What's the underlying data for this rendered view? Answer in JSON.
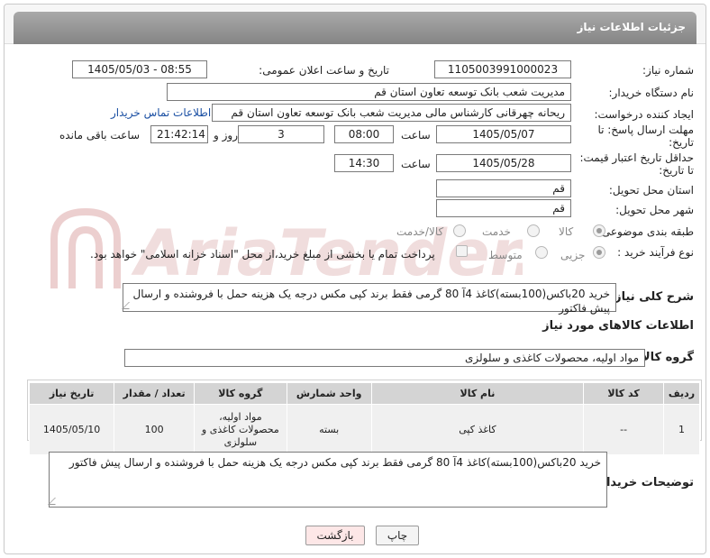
{
  "header": {
    "title": "جزئیات اطلاعات نیاز"
  },
  "fields": {
    "need_number_label": "شماره نیاز:",
    "need_number": "1105003991000023",
    "announce_label": "تاریخ و ساعت اعلان عمومی:",
    "announce_value": "1405/05/03 - 08:55",
    "buyer_org_label": "نام دستگاه خریدار:",
    "buyer_org": "مدیریت شعب بانک توسعه تعاون استان قم",
    "requester_label": "ایجاد کننده درخواست:",
    "requester": "ریحانه چهرقانی کارشناس مالی مدیریت شعب بانک توسعه تعاون استان قم",
    "contact_link": "اطلاعات تماس خریدار",
    "deadline_label_1": "مهلت ارسال پاسخ: تا",
    "deadline_label_2": "تاریخ:",
    "deadline_date": "1405/05/07",
    "time_label": "ساعت",
    "deadline_time": "08:00",
    "days_value": "3",
    "days_label": "روز و",
    "remaining_time": "21:42:14",
    "remaining_label": "ساعت باقی مانده",
    "min_validity_label_1": "حداقل تاریخ اعتبار قیمت:",
    "min_validity_label_2": "تا تاریخ:",
    "validity_date": "1405/05/28",
    "validity_time": "14:30",
    "province_label": "استان محل تحویل:",
    "province": "قم",
    "city_label": "شهر محل تحویل:",
    "city": "قم",
    "category_label": "طبقه بندی موضوعی:",
    "category_options": [
      "کالا",
      "خدمت",
      "کالا/خدمت"
    ],
    "process_label": "نوع فرآیند خرید :",
    "process_options": [
      "جزیی",
      "متوسط"
    ],
    "payment_note": "پرداخت تمام یا بخشی از مبلغ خرید،از محل \"اسناد خزانه اسلامی\" خواهد بود."
  },
  "summary": {
    "label": "شرح کلی نیاز:",
    "text": "خرید 20باکس(100بسته)کاغذ  4آ 80 گرمی فقط برند کپی مکس درجه یک هزینه حمل با فروشنده و ارسال پیش فاکتور"
  },
  "goods_info_title": "اطلاعات کالاهای مورد نیاز",
  "goods_group": {
    "label": "گروه کالا:",
    "value": "مواد اولیه، محصولات کاغذی و سلولزی"
  },
  "table": {
    "headers": [
      "ردیف",
      "کد کالا",
      "نام کالا",
      "واحد شمارش",
      "گروه کالا",
      "تعداد / مقدار",
      "تاریخ نیاز"
    ],
    "rows": [
      [
        "1",
        "--",
        "کاغذ کپی",
        "بسته",
        "مواد اولیه، محصولات کاغذی و سلولزی",
        "100",
        "1405/05/10"
      ]
    ]
  },
  "buyer_notes": {
    "label": "توضیحات خریدار:",
    "text": "خرید 20باکس(100بسته)کاغذ  4آ 80 گرمی فقط برند کپی مکس درجه یک هزینه حمل با فروشنده و ارسال پیش فاکتور"
  },
  "buttons": {
    "print": "چاپ",
    "back": "بازگشت"
  },
  "watermark": {
    "text": "AriaTender.net"
  },
  "colors": {
    "header_bar": "#959595",
    "link": "#1a4fa3",
    "back_button_bg": "#fde7e7",
    "watermark": "#e8c4c4"
  }
}
